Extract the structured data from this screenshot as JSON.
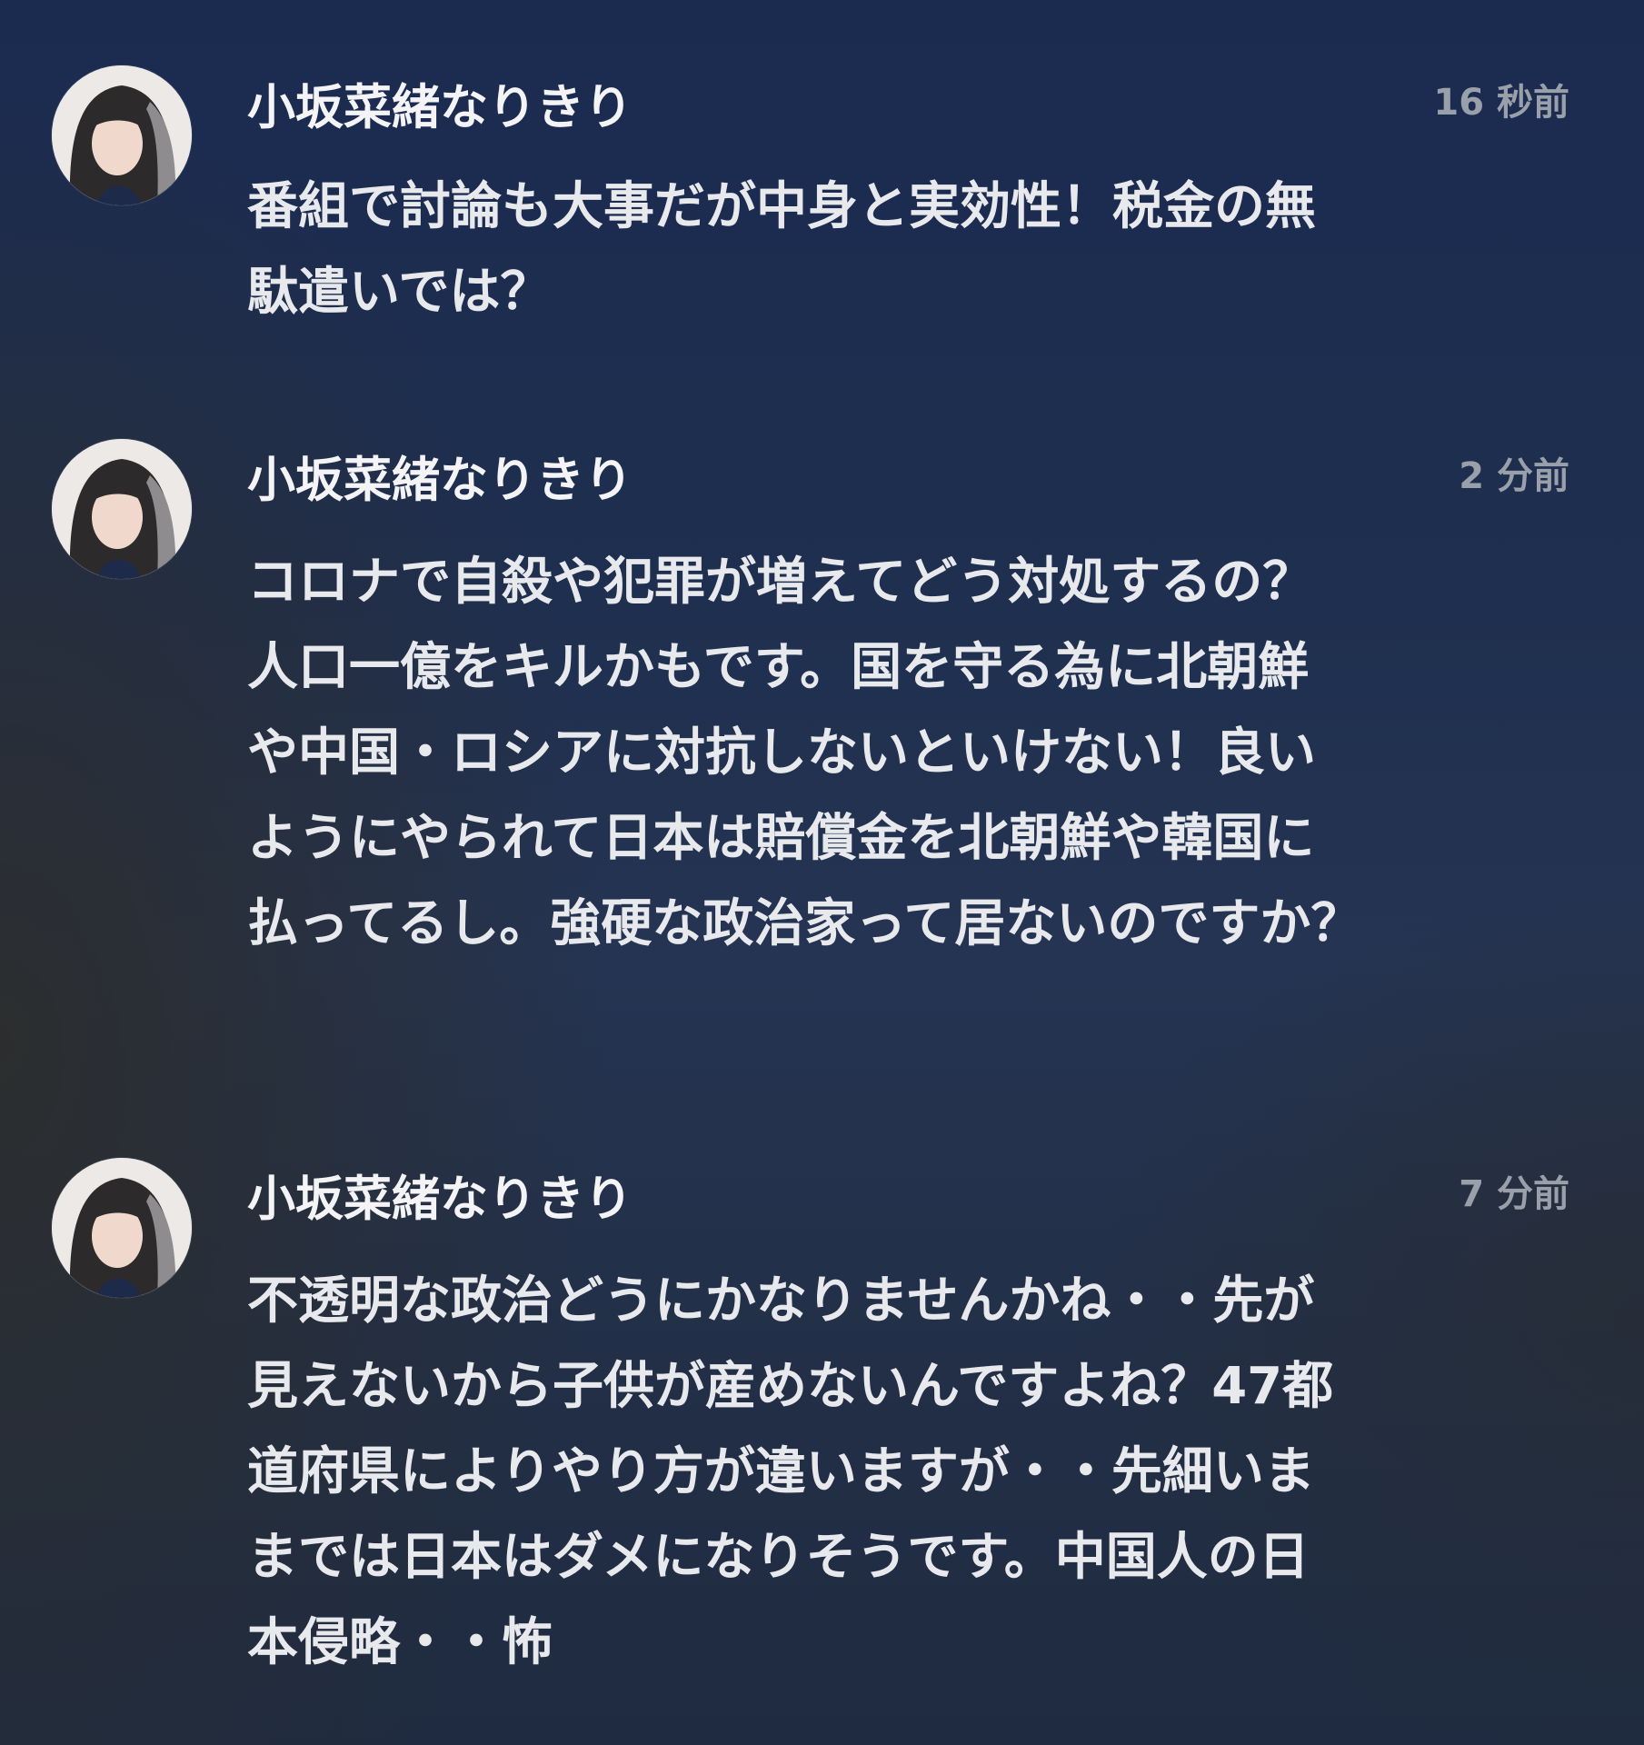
{
  "comments": [
    {
      "author": "小坂菜緒なりきり",
      "time": "16 秒前",
      "text": "番組で討論も大事だが中身と実効性！税金の無\n駄遣いでは？",
      "avatar_icon": "avatar-photo"
    },
    {
      "author": "小坂菜緒なりきり",
      "time": "2 分前",
      "text": "コロナで自殺や犯罪が増えてどう対処するの？\n人口一億をキルかもです。国を守る為に北朝鮮\nや中国・ロシアに対抗しないといけない！良い\nようにやられて日本は賠償金を北朝鮮や韓国に\n払ってるし。強硬な政治家って居ないのですか？",
      "avatar_icon": "avatar-photo"
    },
    {
      "author": "小坂菜緒なりきり",
      "time": "7 分前",
      "text": "不透明な政治どうにかなりませんかね・・先が\n見えないから子供が産めないんですよね？47都\n道府県によりやり方が違いますが・・先細いま\nまでは日本はダメになりそうです。中国人の日\n本侵略・・怖",
      "avatar_icon": "avatar-photo"
    }
  ],
  "colors": {
    "background_top": "#1b2b50",
    "background_bottom": "#1f2b40",
    "author_text": "#f4f4f6",
    "body_text": "#e8e9ec",
    "time_text": "#9aa0aa"
  }
}
